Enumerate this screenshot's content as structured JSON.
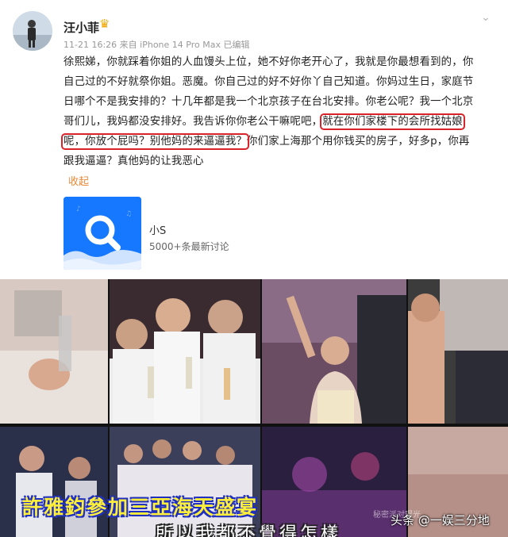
{
  "post": {
    "username": "汪小菲",
    "verified_icon": "crown-icon",
    "meta": "11-21 16:26 来自 iPhone 14 Pro Max 已编辑",
    "text": {
      "lines": [
        "徐熙娣，你就踩着你姐的人血馒头上位，她不好你老开心了，我就是你最想看到的，你",
        "自己过的不好就祭你姐。恶魔。你自己过的好不好你丫自己知道。你妈过生日，家庭节",
        "日哪个不是我安排的？十几年都是我一个北京孩子在台北安排。你老公呢？我一个北京",
        "哥们儿，我妈都没安排好。我告诉你你老公干嘛呢吧，"
      ],
      "highlight_1": "就在你们家楼下的会所找姑娘",
      "line5_highlight": "呢，你放个屁吗？别他妈的来逼逼我？",
      "line5_tail": "你们家上海那个用你钱买的房子，好多p，你再",
      "line6": "跟我逼逼？真他妈的让我恶心"
    },
    "collapse_label": "收起",
    "topic": {
      "icon": "search-icon",
      "name": "小S",
      "count": "5000+条最新讨论"
    }
  },
  "collage": {
    "caption_main": "許雅鈞參加三亞海天盛宴",
    "caption_sub": "所以我都不覺得怎樣",
    "source_watermark": "秘密派对曝光",
    "watermark": "头条 @一娱三分地"
  },
  "colors": {
    "highlight_border": "#d8232a",
    "collapse": "#ea8a3a",
    "topic_icon_bg": "#1677ff",
    "caption_yellow": "#ffee3a"
  }
}
